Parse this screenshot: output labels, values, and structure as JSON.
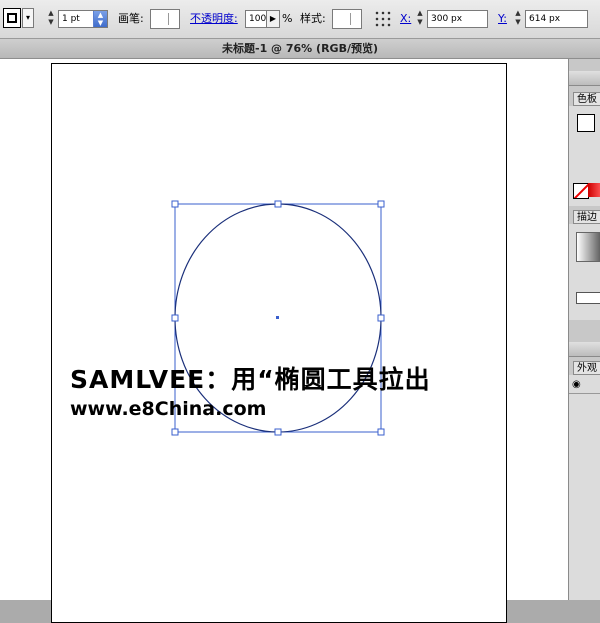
{
  "control_bar": {
    "stroke_weight": "1 pt",
    "brush_label": "画笔:",
    "opacity_label": "不透明度:",
    "opacity_value": "100",
    "percent_sign": "%",
    "style_label": "样式:",
    "x_label": "X:",
    "x_value": "300 px",
    "y_label": "Y:",
    "y_value": "614 px"
  },
  "document": {
    "title": "未标题-1 @ 76% (RGB/预览)"
  },
  "canvas": {
    "caption_line1": "SAMLVEE：用“椭圆工具拉出",
    "caption_line2": "www.e8China.com",
    "selection_color": "#3a5fcd",
    "shape": "ellipse"
  },
  "panels": {
    "swatches_tab": "色板",
    "stroke_tab": "描边",
    "appearance_tab": "外观"
  },
  "icons": [
    "fill-stroke-swatch-icon",
    "dropdown-arrow-icon",
    "spinner-icon",
    "reference-point-grid-icon",
    "eye-icon",
    "none-swatch-icon"
  ]
}
